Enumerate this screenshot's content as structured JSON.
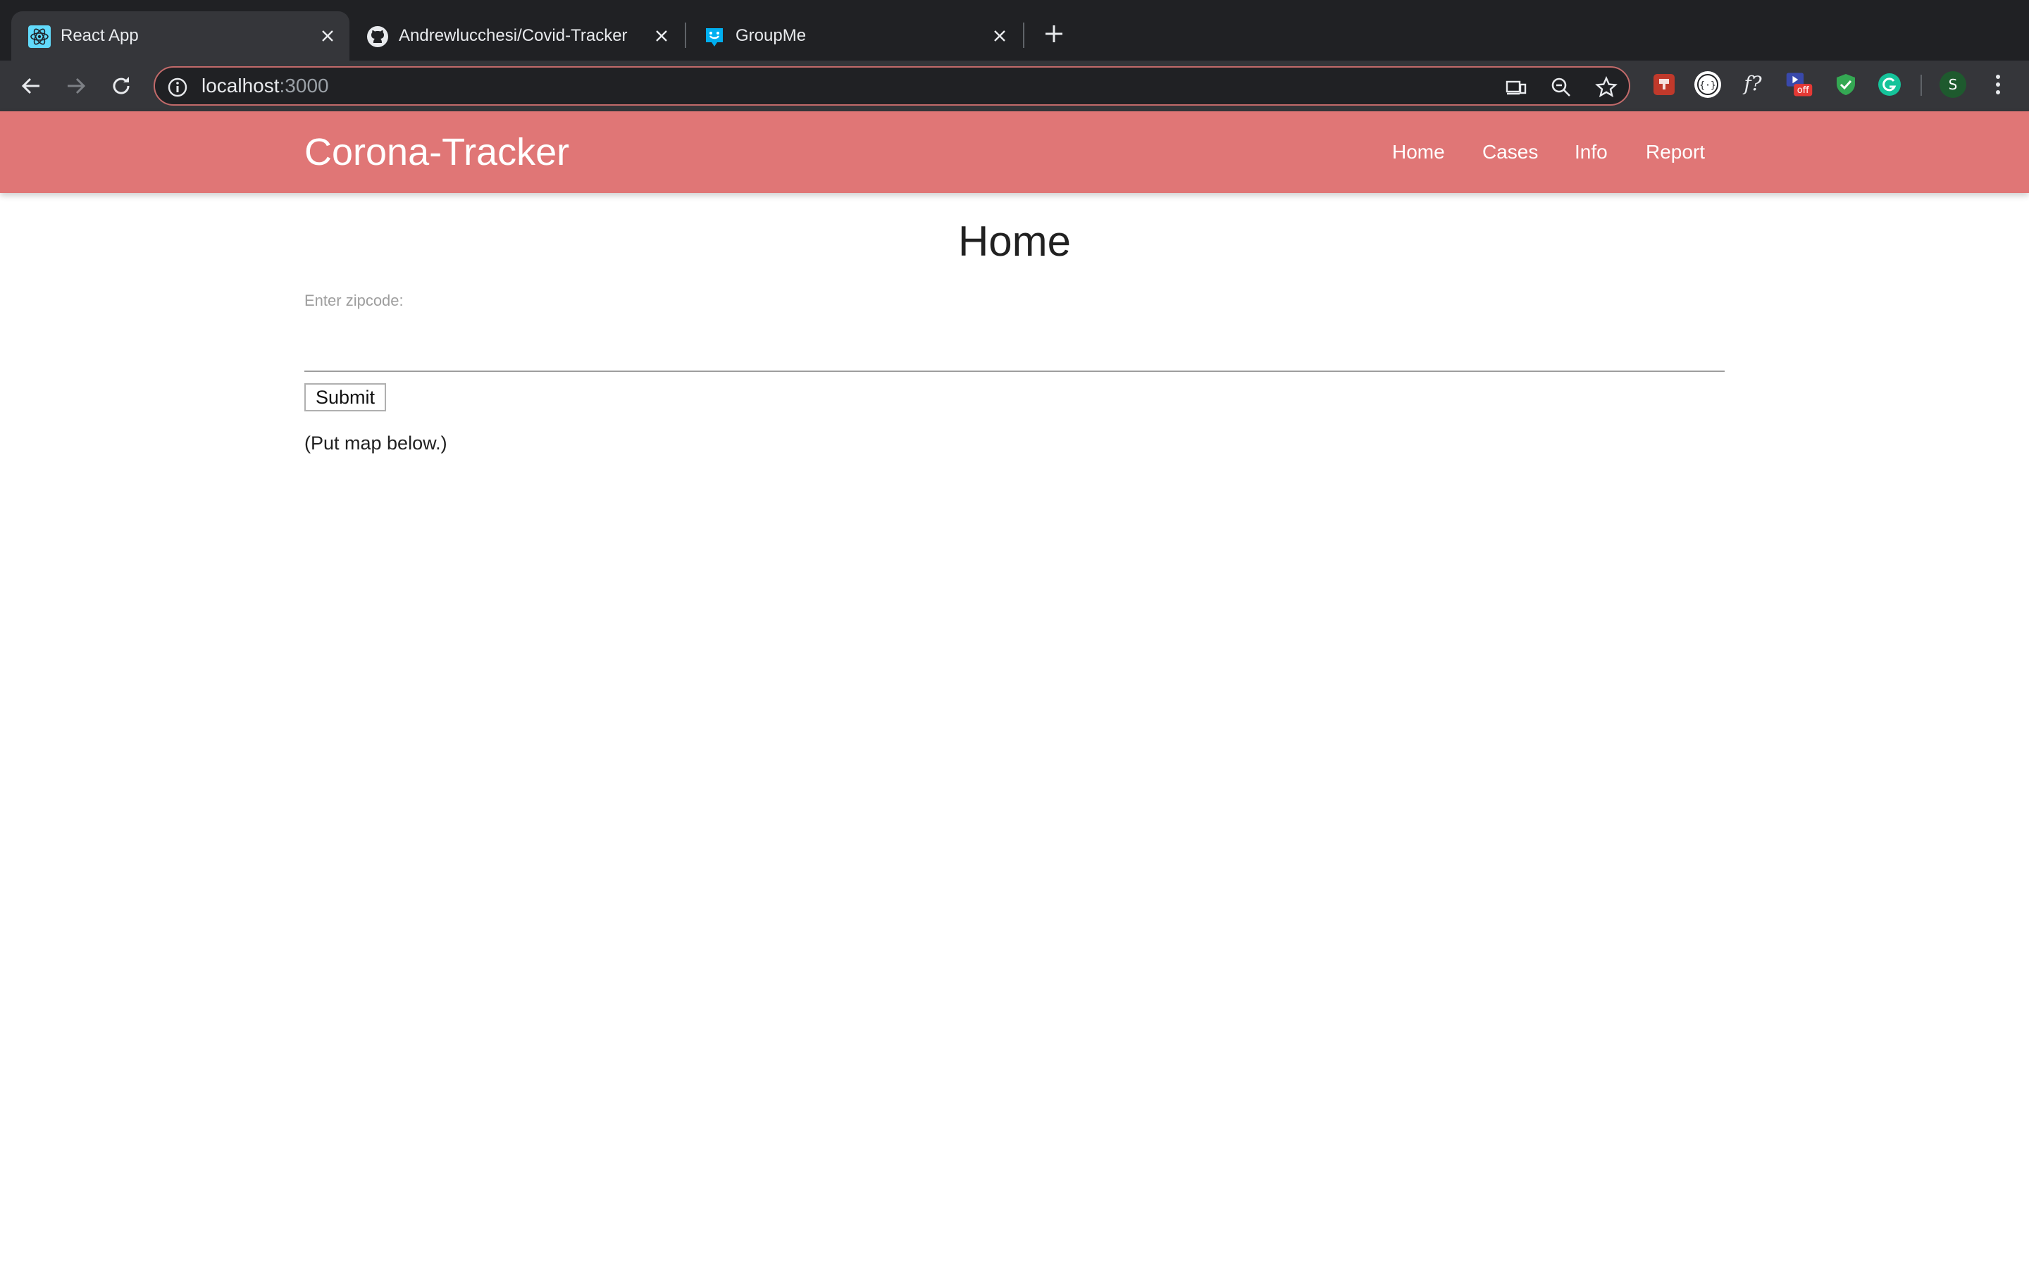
{
  "browser": {
    "tabs": [
      {
        "title": "React App",
        "icon": "react-icon",
        "active": true
      },
      {
        "title": "Andrewlucchesi/Covid-Tracker",
        "icon": "github-icon",
        "active": false
      },
      {
        "title": "GroupMe",
        "icon": "groupme-icon",
        "active": false
      }
    ],
    "address": {
      "host": "localhost",
      "port": ":3000"
    },
    "profile_initial": "S",
    "extension_badge": "off",
    "extension_fx_label": "f?"
  },
  "app": {
    "brand": "Corona-Tracker",
    "nav": [
      "Home",
      "Cases",
      "Info",
      "Report"
    ],
    "accent_color": "#e07676"
  },
  "home": {
    "title": "Home",
    "zip_label": "Enter zipcode:",
    "zip_value": "",
    "submit_label": "Submit",
    "map_note": "(Put map below.)"
  }
}
